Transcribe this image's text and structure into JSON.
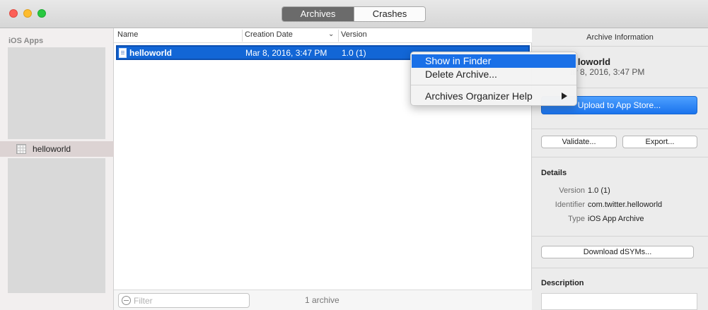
{
  "toolbar": {
    "tabs": [
      {
        "label": "Archives",
        "active": true
      },
      {
        "label": "Crashes",
        "active": false
      }
    ]
  },
  "sidebar": {
    "header": "iOS Apps",
    "items": [
      {
        "label": "helloworld",
        "selected": true
      }
    ]
  },
  "list": {
    "columns": [
      "Name",
      "Creation Date",
      "Version"
    ],
    "sorted_column": "Creation Date",
    "rows": [
      {
        "name": "helloworld",
        "creation_date": "Mar 8, 2016, 3:47 PM",
        "version": "1.0 (1)",
        "selected": true
      }
    ],
    "filter_placeholder": "Filter",
    "count_label": "1 archive"
  },
  "context_menu": {
    "items": [
      {
        "label": "Show in Finder",
        "highlighted": true
      },
      {
        "label": "Delete Archive...",
        "highlighted": false
      },
      {
        "label": "Archives Organizer Help",
        "highlighted": false,
        "has_submenu": true
      }
    ]
  },
  "info_panel": {
    "title": "Archive Information",
    "archive_name": "elloworld",
    "archive_date": "ar 8, 2016, 3:47 PM",
    "upload_label": "Upload to App Store...",
    "validate_label": "Validate...",
    "export_label": "Export...",
    "details_title": "Details",
    "details": [
      {
        "key": "Version",
        "value": "1.0 (1)"
      },
      {
        "key": "Identifier",
        "value": "com.twitter.helloworld"
      },
      {
        "key": "Type",
        "value": "iOS App Archive"
      }
    ],
    "download_dsyms_label": "Download dSYMs...",
    "description_title": "Description"
  },
  "colors": {
    "selection_blue": "#1266d6",
    "menu_highlight": "#1a70e7",
    "primary_button": "#1a73ed",
    "active_tab": "#6b6b6b"
  }
}
